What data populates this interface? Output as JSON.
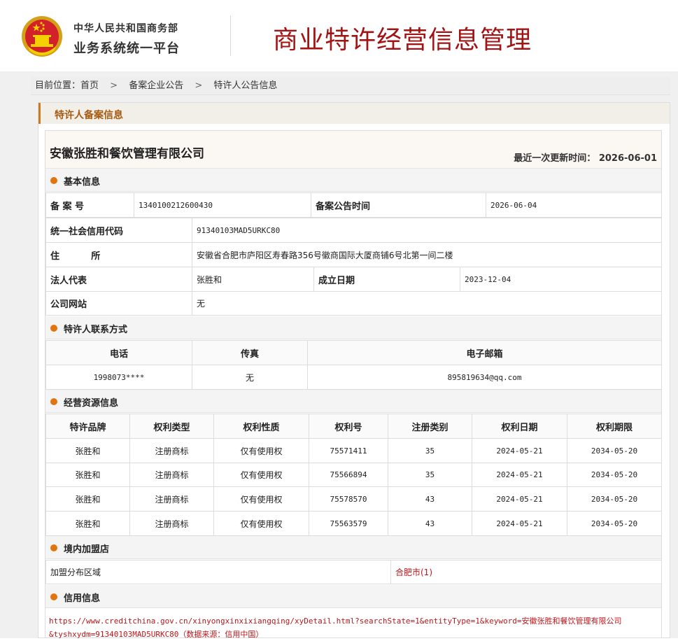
{
  "header": {
    "org_line1": "中华人民共和国商务部",
    "org_line2": "业务系统统一平台",
    "site_title": "商业特许经营信息管理",
    "emblem_icon": "national-emblem-icon"
  },
  "breadcrumb": {
    "prefix": "目前位置：",
    "items": [
      "首页",
      "备案企业公告",
      "特许人公告信息"
    ],
    "separator": ">"
  },
  "panel": {
    "title": "特许人备案信息"
  },
  "company": {
    "name": "安徽张胜和餐饮管理有限公司",
    "last_updated_label": "最近一次更新时间：",
    "last_updated": "2026-06-01"
  },
  "basic_info": {
    "section_title": "基本信息",
    "record_no_label": "备 案 号",
    "record_no": "1340100212600430",
    "announce_time_label": "备案公告时间",
    "announce_time": "2026-06-04",
    "credit_code_label": "统一社会信用代码",
    "credit_code": "91340103MAD5URKC80",
    "address_label": "住          所",
    "address": "安徽省合肥市庐阳区寿春路356号徽商国际大厦商铺6号北第一间二楼",
    "legal_rep_label": "法人代表",
    "legal_rep": "张胜和",
    "founded_label": "成立日期",
    "founded": "2023-12-04",
    "website_label": "公司网站",
    "website": "无"
  },
  "contact": {
    "section_title": "特许人联系方式",
    "headers": [
      "电话",
      "传真",
      "电子邮箱"
    ],
    "phone": "1998073****",
    "fax": "无",
    "email": "895819634@qq.com"
  },
  "resources": {
    "section_title": "经营资源信息",
    "headers": [
      "特许品牌",
      "权利类型",
      "权利性质",
      "权利号",
      "注册类别",
      "权利日期",
      "权利期限"
    ],
    "rows": [
      [
        "张胜和",
        "注册商标",
        "仅有使用权",
        "75571411",
        "35",
        "2024-05-21",
        "2034-05-20"
      ],
      [
        "张胜和",
        "注册商标",
        "仅有使用权",
        "75566894",
        "35",
        "2024-05-21",
        "2034-05-20"
      ],
      [
        "张胜和",
        "注册商标",
        "仅有使用权",
        "75578570",
        "43",
        "2024-05-21",
        "2034-05-20"
      ],
      [
        "张胜和",
        "注册商标",
        "仅有使用权",
        "75563579",
        "43",
        "2024-05-21",
        "2034-05-20"
      ]
    ]
  },
  "stores": {
    "section_title": "境内加盟店",
    "area_label": "加盟分布区域",
    "area_value": "合肥市(1)"
  },
  "credit": {
    "section_title": "信用信息",
    "url_line1": "https://www.creditchina.gov.cn/xinyongxinxixiangqing/xyDetail.html?searchState=1&entityType=1&keyword=安徽张胜和餐饮管理有限公司",
    "url_line2": "&tyshxydm=91340103MAD5URKC80（数据来源：信用中国）"
  },
  "colors": {
    "title_red": "#a21313",
    "accent_orange": "#e2740f",
    "link_red": "#c0151a"
  }
}
